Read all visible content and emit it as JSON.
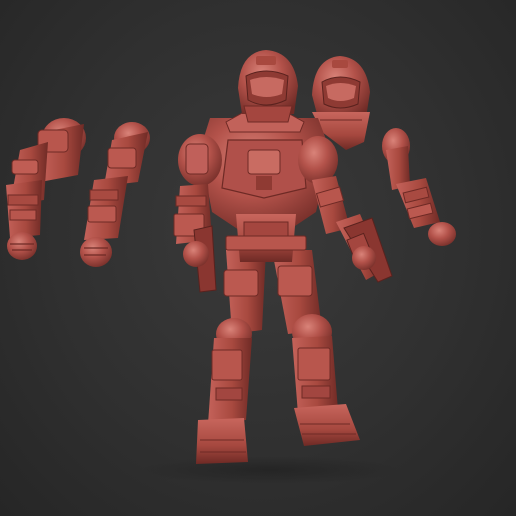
{
  "scene": {
    "background_color": "#2f2f2f",
    "clay_color": "#b3524a",
    "clay_dark": "#6e2a25",
    "clay_light": "#d9837a",
    "figure_type": "armored-soldier-sculpt",
    "parts": [
      "spare-left-arm",
      "spare-right-arm",
      "spare-helmet",
      "spare-forearm",
      "main-figure"
    ]
  }
}
